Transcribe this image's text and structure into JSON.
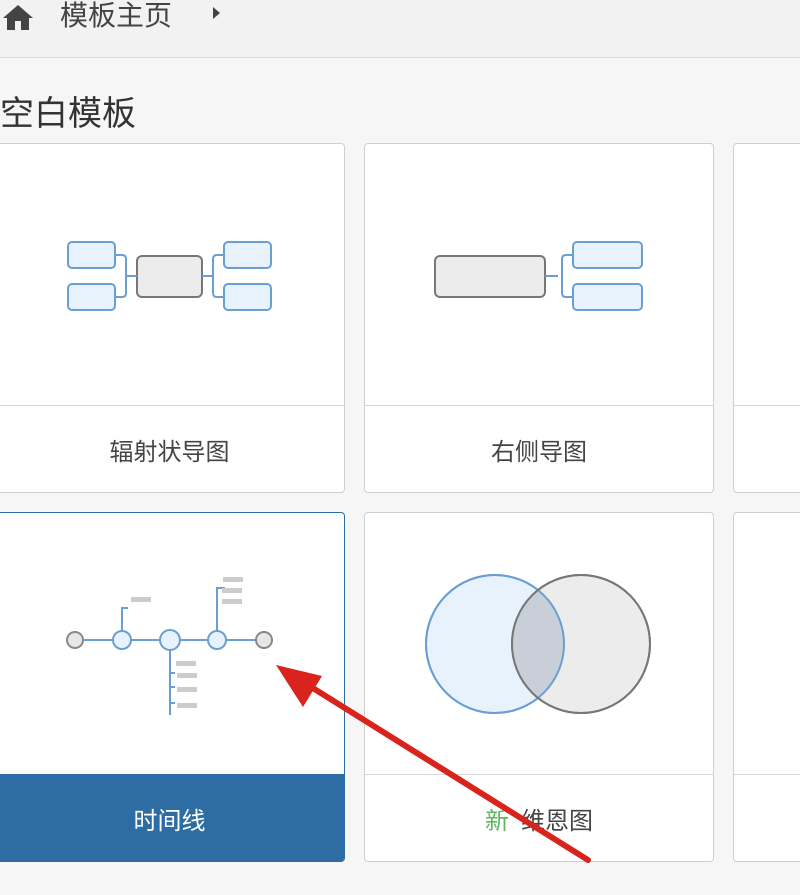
{
  "breadcrumb": {
    "home_icon": "home-icon",
    "current": "模板主页",
    "caret_icon": "caret-right-icon"
  },
  "section": {
    "title": "空白模板"
  },
  "templates": [
    {
      "label": "辐射状导图",
      "icon": "radial-map-icon"
    },
    {
      "label": "右侧导图",
      "icon": "right-map-icon"
    },
    {
      "label": "时间线",
      "icon": "timeline-icon",
      "selected": true
    },
    {
      "label": "维恩图",
      "badge": "新",
      "icon": "venn-diagram-icon"
    }
  ],
  "next_section": {
    "title": ""
  },
  "colors": {
    "accent": "#2e6da4",
    "new_badge": "#5cb85c",
    "annotation_arrow": "#d9231d",
    "node_fill": "#e8f2fd",
    "node_stroke": "#6a9fd3"
  }
}
